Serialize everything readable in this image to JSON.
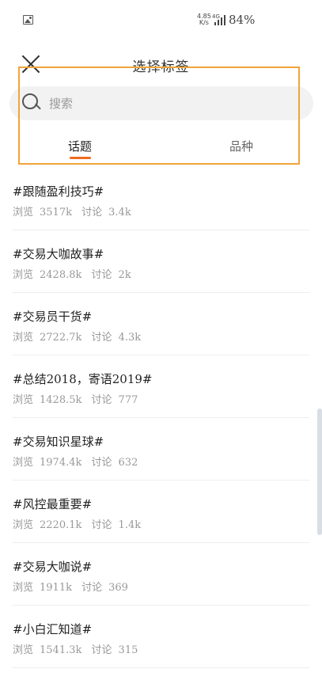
{
  "status_bar": {
    "net_speed_value": "4.85",
    "net_speed_unit": "K/s",
    "network": "4G",
    "battery": "84%"
  },
  "header": {
    "title": "选择标签"
  },
  "search": {
    "placeholder": "搜索"
  },
  "tabs": [
    {
      "label": "话题",
      "active": true
    },
    {
      "label": "品种",
      "active": false
    }
  ],
  "topics": [
    {
      "title": "#跟随盈利技巧#",
      "views_label": "浏览",
      "views": "3517k",
      "comments_label": "讨论",
      "comments": "3.4k"
    },
    {
      "title": "#交易大咖故事#",
      "views_label": "浏览",
      "views": "2428.8k",
      "comments_label": "讨论",
      "comments": "2k"
    },
    {
      "title": "#交易员干货#",
      "views_label": "浏览",
      "views": "2722.7k",
      "comments_label": "讨论",
      "comments": "4.3k"
    },
    {
      "title": "#总结2018，寄语2019#",
      "views_label": "浏览",
      "views": "1428.5k",
      "comments_label": "讨论",
      "comments": "777"
    },
    {
      "title": "#交易知识星球#",
      "views_label": "浏览",
      "views": "1974.4k",
      "comments_label": "讨论",
      "comments": "632"
    },
    {
      "title": "#风控最重要#",
      "views_label": "浏览",
      "views": "2220.1k",
      "comments_label": "讨论",
      "comments": "1.4k"
    },
    {
      "title": "#交易大咖说#",
      "views_label": "浏览",
      "views": "1911k",
      "comments_label": "讨论",
      "comments": "369"
    },
    {
      "title": "#小白汇知道#",
      "views_label": "浏览",
      "views": "1541.3k",
      "comments_label": "讨论",
      "comments": "315"
    }
  ],
  "colors": {
    "accent": "#f06a1e",
    "highlight_border": "#f0a43a",
    "search_bg": "#f2f2f2"
  }
}
